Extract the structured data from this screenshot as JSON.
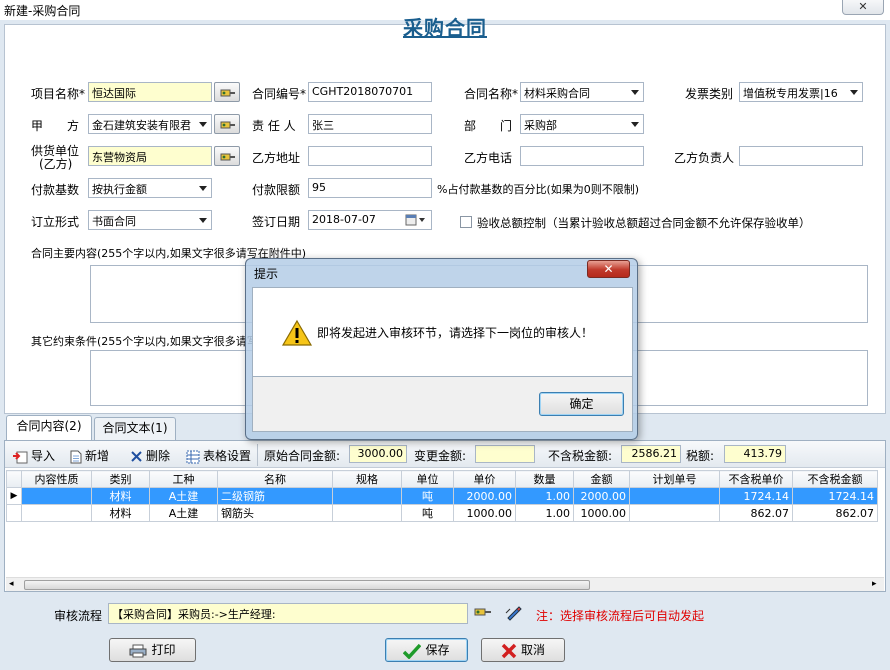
{
  "window": {
    "title": "新建-采购合同",
    "close_label": "✕"
  },
  "form": {
    "title": "采购合同",
    "project_name_label": "项目名称",
    "project_name": "恒达国际",
    "contract_no_label": "合同编号",
    "contract_no": "CGHT2018070701",
    "contract_name_label": "合同名称",
    "contract_name": "材料采购合同",
    "invoice_type_label": "发票类别",
    "invoice_type": "增值税专用发票|16",
    "party_a_label": "甲　　方",
    "party_a": "金石建筑安装有限君",
    "responsible_label": "责 任 人",
    "responsible": "张三",
    "department_label": "部　　门",
    "department": "采购部",
    "supplier_label_1": "供货单位",
    "supplier_label_2": "(乙方)",
    "supplier": "东营物资局",
    "party_b_address_label": "乙方地址",
    "party_b_address": "",
    "party_b_phone_label": "乙方电话",
    "party_b_phone": "",
    "party_b_owner_label": "乙方负责人",
    "party_b_owner": "",
    "pay_base_label": "付款基数",
    "pay_base": "按执行金额",
    "pay_limit_label": "付款限额",
    "pay_limit": "95",
    "pay_limit_note": "%占付款基数的百分比(如果为0则不限制)",
    "form_type_label": "订立形式",
    "form_type": "书面合同",
    "sign_date_label": "签订日期",
    "sign_date": "2018-07-07",
    "acceptance_control_label": "验收总额控制（当累计验收总额超过合同金额不允许保存验收单）",
    "main_content_label": "合同主要内容(255个字以内,如果文字很多请写在附件中)",
    "other_terms_label": "其它约束条件(255个字以内,如果文字很多请写在附件中)",
    "required_mark": "*"
  },
  "tabs": [
    {
      "label": "合同内容(2)"
    },
    {
      "label": "合同文本(1)"
    }
  ],
  "toolbar": {
    "import_label": "导入",
    "add_label": "新增",
    "delete_label": "删除",
    "table_settings_label": "表格设置",
    "original_amount_label": "原始合同金额:",
    "original_amount": "3000.00",
    "change_amount_label": "变更金额:",
    "change_amount": "",
    "pretax_amount_label": "不含税金额:",
    "pretax_amount": "2586.21",
    "tax_label": "税额:",
    "tax": "413.79"
  },
  "grid": {
    "columns": [
      "内容性质",
      "类别",
      "工种",
      "名称",
      "规格",
      "单位",
      "单价",
      "数量",
      "金额",
      "计划单号",
      "不含税单价",
      "不含税金额"
    ],
    "rows": [
      [
        "",
        "材料",
        "A土建",
        "二级钢筋",
        "",
        "吨",
        "2000.00",
        "1.00",
        "2000.00",
        "",
        "1724.14",
        "1724.14"
      ],
      [
        "",
        "材料",
        "A土建",
        "钢筋头",
        "",
        "吨",
        "1000.00",
        "1.00",
        "1000.00",
        "",
        "862.07",
        "862.07"
      ]
    ],
    "row_indicator": "▶"
  },
  "flow": {
    "label": "审核流程",
    "value": "【采购合同】采购员:->生产经理:",
    "note": "注：选择审核流程后可自动发起"
  },
  "buttons": {
    "print_label": "打印",
    "save_label": "保存",
    "cancel_label": "取消"
  },
  "dialog": {
    "title": "提示",
    "message": "即将发起进入审核环节，请选择下一岗位的审核人！",
    "ok_label": "确定",
    "close_label": "✕"
  }
}
